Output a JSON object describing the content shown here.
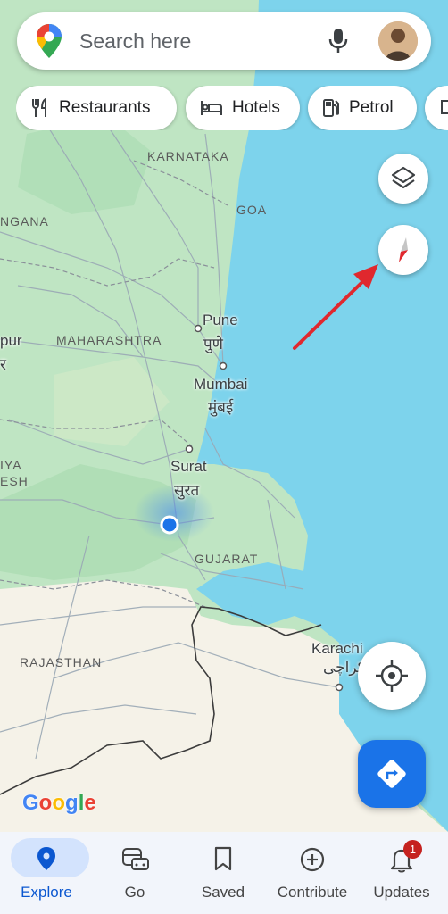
{
  "search": {
    "placeholder": "Search here"
  },
  "chips": [
    {
      "label": "Restaurants",
      "icon": "restaurant-icon"
    },
    {
      "label": "Hotels",
      "icon": "hotel-icon"
    },
    {
      "label": "Petrol",
      "icon": "gas-station-icon"
    },
    {
      "label": "",
      "icon": "more-chip-icon"
    }
  ],
  "map": {
    "regions": [
      "KARNATAKA",
      "GOA",
      "NGANA",
      "MAHARASHTRA",
      "GUJARAT",
      "RAJASTHAN",
      "IYA",
      "ESH"
    ],
    "cities": [
      {
        "name": "Pune",
        "native": "पुणे"
      },
      {
        "name": "Mumbai",
        "native": "मुंबई"
      },
      {
        "name": "Surat",
        "native": "सुरत"
      },
      {
        "name": "Karachi",
        "native": "کراچی"
      }
    ],
    "edge_labels": [
      "pur",
      "र"
    ],
    "logo": "Google",
    "colors": {
      "water": "#7dd3ec",
      "land_green": "#bfe5c3",
      "land_cream": "#f5f2e8",
      "accent": "#1a73e8",
      "arrow": "#e0282e"
    }
  },
  "nav": {
    "items": [
      {
        "label": "Explore",
        "icon": "explore-pin-icon",
        "active": true
      },
      {
        "label": "Go",
        "icon": "go-car-icon",
        "active": false
      },
      {
        "label": "Saved",
        "icon": "bookmark-icon",
        "active": false
      },
      {
        "label": "Contribute",
        "icon": "add-circle-icon",
        "active": false
      },
      {
        "label": "Updates",
        "icon": "bell-icon",
        "active": false
      }
    ],
    "updates_badge": "1"
  }
}
